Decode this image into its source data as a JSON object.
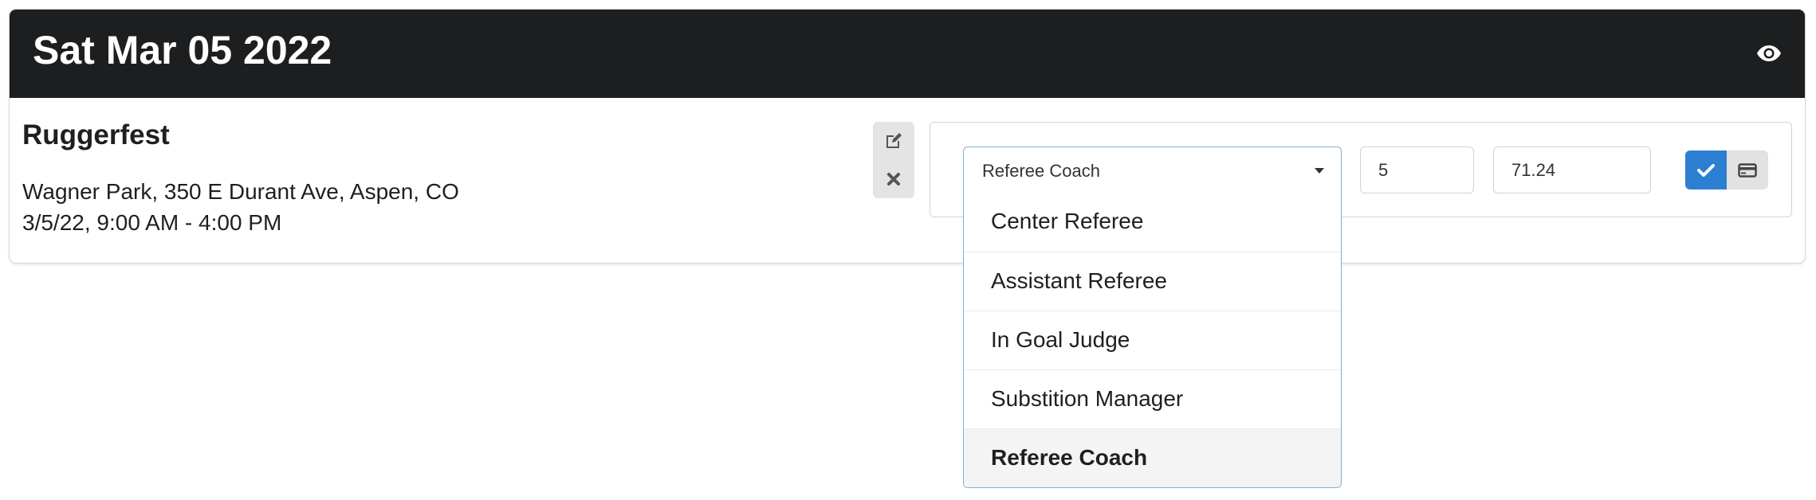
{
  "header": {
    "date": "Sat Mar 05 2022",
    "visibility_icon": "eye-icon"
  },
  "event": {
    "title": "Ruggerfest",
    "location": "Wagner Park, 350 E Durant Ave, Aspen, CO",
    "time": "3/5/22, 9:00 AM - 4:00 PM"
  },
  "actions": {
    "edit_icon": "edit-icon",
    "delete_icon": "close-icon"
  },
  "form": {
    "role_select": {
      "selected": "Referee Coach",
      "options": [
        "Center Referee",
        "Assistant Referee",
        "In Goal Judge",
        "Substition Manager",
        "Referee Coach"
      ]
    },
    "quantity_value": "5",
    "rate_value": "71.24",
    "confirm_icon": "check-icon",
    "payment_icon": "credit-card-icon"
  },
  "colors": {
    "header_bg": "#1d1e20",
    "primary": "#2d7fd2",
    "select_border": "#7fb2cf"
  }
}
